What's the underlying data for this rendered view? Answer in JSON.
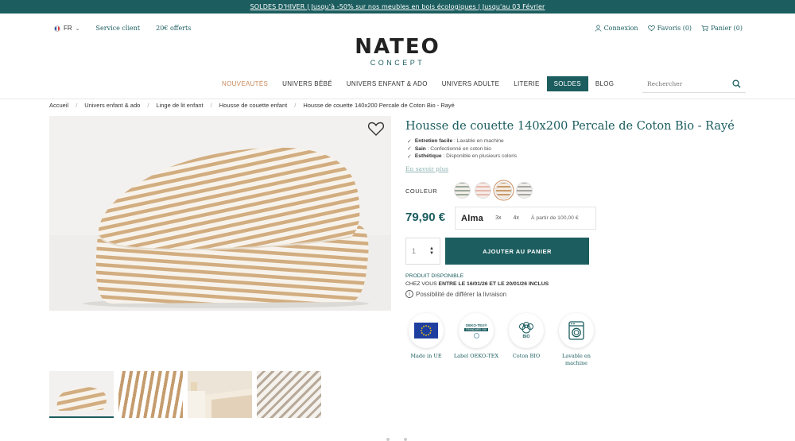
{
  "promo": {
    "text": "SOLDES D'HIVER | Jusqu'à -50% sur nos meubles en bois écologiques | Jusqu'au 03 Février"
  },
  "header": {
    "lang": "FR",
    "service": "Service client",
    "offer": "20€ offerts",
    "login": "Connexion",
    "favorites": "Favoris (0)",
    "cart": "Panier (0)",
    "logo_main": "NATEO",
    "logo_sub": "CONCEPT",
    "search_placeholder": "Rechercher"
  },
  "nav": {
    "items": [
      "NOUVEAUTÉS",
      "UNIVERS BÉBÉ",
      "UNIVERS ENFANT & ADO",
      "UNIVERS ADULTE",
      "LITERIE",
      "SOLDES",
      "BLOG"
    ]
  },
  "breadcrumb": [
    "Accueil",
    "Univers enfant & ado",
    "Linge de lit enfant",
    "Housse de couette enfant",
    "Housse de couette 140x200 Percale de Coton Bio - Rayé"
  ],
  "product": {
    "title": "Housse de couette 140x200 Percale de Coton Bio - Rayé",
    "features": [
      {
        "name": "Entretien facile",
        "desc": " : Lavable en machine"
      },
      {
        "name": "Sain",
        "desc": " : Confectionné en coton bio"
      },
      {
        "name": "Esthétique",
        "desc": " : Disponible en plusieurs coloris"
      }
    ],
    "learn_more": "En savoir plus",
    "color_label": "COULEUR",
    "price": "79,90 €",
    "alma": {
      "logo": "Alma",
      "opt1": "3x",
      "opt2": "4x",
      "note": "À partir de 100,00 €"
    },
    "quantity": "1",
    "add_to_cart": "AJOUTER AU PANIER",
    "availability": "PRODUIT DISPONIBLE",
    "delivery_prefix": "CHEZ VOUS ",
    "delivery_dates": "ENTRE LE 16/01/26 ET LE 20/01/26 INCLUS",
    "defer": "Possibilité de différer la livraison",
    "badges": [
      {
        "label": "Made in UE"
      },
      {
        "label": "Label OEKO-TEX"
      },
      {
        "label": "Coton BIO"
      },
      {
        "label": "Lavable en machine"
      }
    ],
    "oeko_line1": "OEKO-TEX®",
    "oeko_line2": "STANDARD 100",
    "bio_text": "BIO"
  },
  "colors": {
    "brand": "#1c5d5f",
    "accent": "#c98a5a"
  }
}
